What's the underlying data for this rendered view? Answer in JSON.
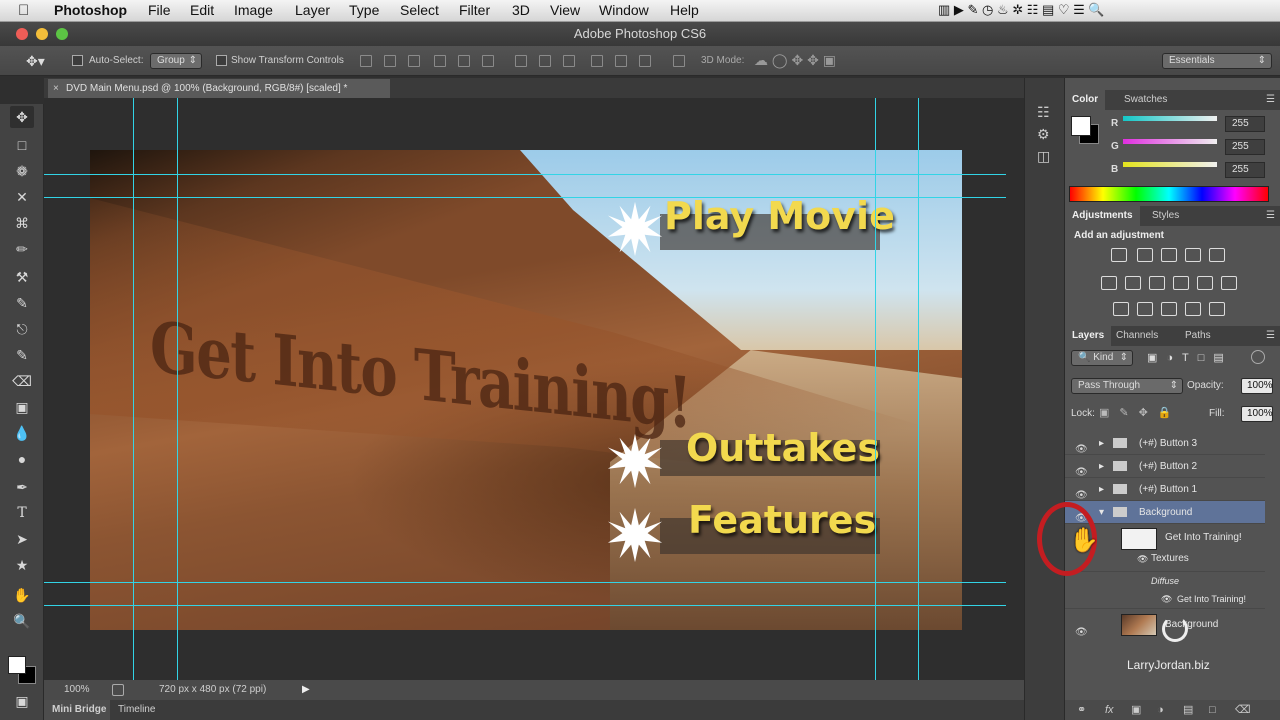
{
  "menubar": {
    "app": "Photoshop",
    "items": [
      "File",
      "Edit",
      "Image",
      "Layer",
      "Type",
      "Select",
      "Filter",
      "3D",
      "View",
      "Window",
      "Help"
    ]
  },
  "window_title": "Adobe Photoshop CS6",
  "options": {
    "auto_select_label": "Auto-Select:",
    "auto_select_value": "Group",
    "transform_label": "Show Transform Controls",
    "mode3d_label": "3D Mode:",
    "workspace": "Essentials"
  },
  "document": {
    "tab_title": "DVD Main Menu.psd @ 100% (Background, RGB/8#) [scaled] *",
    "zoom": "100%",
    "doc_info": "720 px x 480 px (72 ppi)"
  },
  "canvas": {
    "engraved_text": "Get Into Training!",
    "buttons": [
      "Play Movie",
      "Outtakes",
      "Features"
    ]
  },
  "bottom_tabs": [
    "Mini Bridge",
    "Timeline"
  ],
  "color_panel": {
    "tabs": [
      "Color",
      "Swatches"
    ],
    "channels": [
      {
        "label": "R",
        "value": "255",
        "color": "#22e1e1"
      },
      {
        "label": "G",
        "value": "255",
        "color": "#e639e6"
      },
      {
        "label": "B",
        "value": "255",
        "color": "#eaea22"
      }
    ]
  },
  "adjustments_panel": {
    "tabs": [
      "Adjustments",
      "Styles"
    ],
    "heading": "Add an adjustment"
  },
  "layers_panel": {
    "tabs": [
      "Layers",
      "Channels",
      "Paths"
    ],
    "filter": "Kind",
    "blend_mode": "Pass Through",
    "opacity_label": "Opacity:",
    "opacity_value": "100%",
    "lock_label": "Lock:",
    "fill_label": "Fill:",
    "fill_value": "100%",
    "layers": [
      {
        "name": "(+#) Button 3"
      },
      {
        "name": "(+#) Button 2"
      },
      {
        "name": "(+#) Button 1"
      },
      {
        "name": "Background"
      },
      {
        "name": "Get Into Training!"
      },
      {
        "name": "Textures"
      },
      {
        "name": "Diffuse"
      },
      {
        "name": "Get Into Training!"
      },
      {
        "name": "Background"
      }
    ]
  },
  "watermark": "LarryJordan.biz"
}
